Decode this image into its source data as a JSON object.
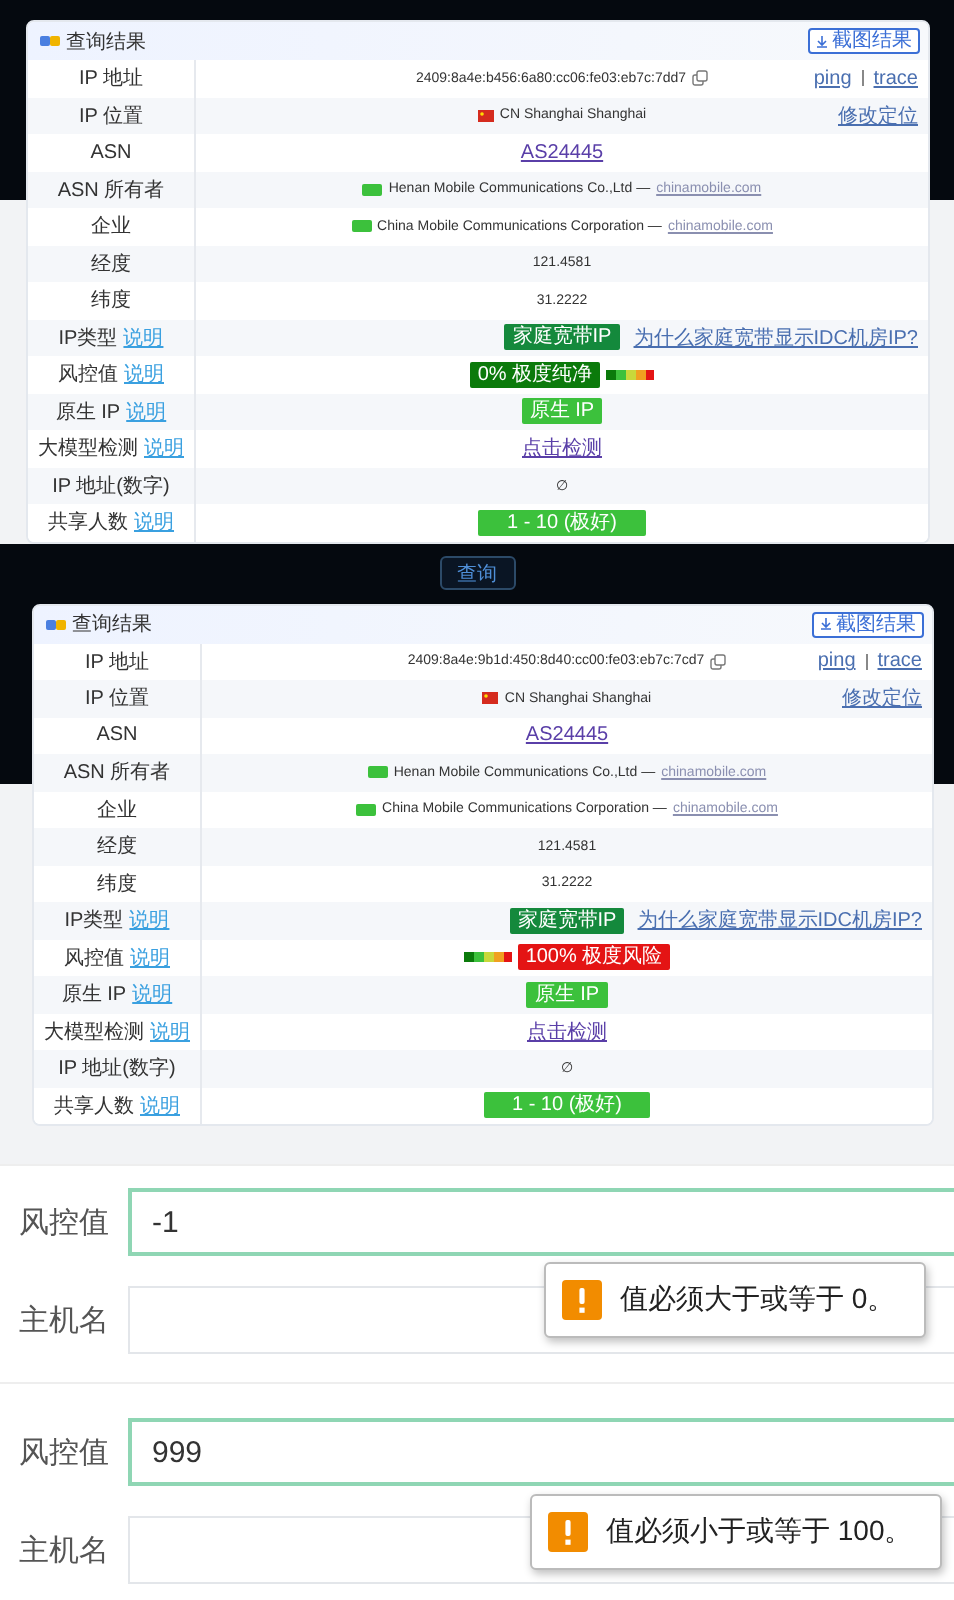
{
  "panels": [
    {
      "title": "查询结果",
      "action": "截图结果",
      "rows": [
        {
          "kind": "ip",
          "label": "IP 地址",
          "value": "2409:8a4e:b456:6a80:cc06:fe03:eb7c:7dd7",
          "links": [
            "ping",
            "trace"
          ]
        },
        {
          "kind": "location",
          "label": "IP 位置",
          "value": "CN Shanghai Shanghai",
          "links": [
            "修改定位"
          ]
        },
        {
          "kind": "link",
          "label": "ASN",
          "value": "AS24445"
        },
        {
          "kind": "org",
          "label": "ASN 所有者",
          "value": "Henan Mobile Communications Co.,Ltd —",
          "domain": "chinamobile.com"
        },
        {
          "kind": "org",
          "label": "企业",
          "value": "China Mobile Communications Corporation —",
          "domain": "chinamobile.com"
        },
        {
          "kind": "text",
          "label": "经度",
          "value": "121.4581"
        },
        {
          "kind": "text",
          "label": "纬度",
          "value": "31.2222"
        },
        {
          "kind": "badge",
          "label": "IP类型",
          "help": "说明",
          "value": "家庭宽带IP",
          "color": "#14893c",
          "links": [
            "为什么家庭宽带显示IDC机房IP?"
          ]
        },
        {
          "kind": "risk",
          "label": "风控值",
          "help": "说明",
          "value": "0%  极度纯净",
          "color": "#0b7a0b"
        },
        {
          "kind": "badge",
          "label": "原生 IP",
          "help": "说明",
          "value": "原生 IP",
          "color": "#3cc13c"
        },
        {
          "kind": "link",
          "label": "大模型检测",
          "help": "说明",
          "value": "点击检测"
        },
        {
          "kind": "text",
          "label": "IP 地址(数字)",
          "value": "∅"
        },
        {
          "kind": "wide-badge",
          "label": "共享人数",
          "help": "说明",
          "value": "1 - 10 (极好)",
          "color": "#3cc13c"
        }
      ],
      "search_button": "查询"
    },
    {
      "title": "查询结果",
      "action": "截图结果",
      "rows": [
        {
          "kind": "ip",
          "label": "IP 地址",
          "value": "2409:8a4e:9b1d:450:8d40:cc00:fe03:eb7c:7cd7",
          "links": [
            "ping",
            "trace"
          ]
        },
        {
          "kind": "location",
          "label": "IP 位置",
          "value": "CN Shanghai Shanghai",
          "links": [
            "修改定位"
          ]
        },
        {
          "kind": "link",
          "label": "ASN",
          "value": "AS24445"
        },
        {
          "kind": "org",
          "label": "ASN 所有者",
          "value": "Henan Mobile Communications Co.,Ltd —",
          "domain": "chinamobile.com"
        },
        {
          "kind": "org",
          "label": "企业",
          "value": "China Mobile Communications Corporation —",
          "domain": "chinamobile.com"
        },
        {
          "kind": "text",
          "label": "经度",
          "value": "121.4581"
        },
        {
          "kind": "text",
          "label": "纬度",
          "value": "31.2222"
        },
        {
          "kind": "badge",
          "label": "IP类型",
          "help": "说明",
          "value": "家庭宽带IP",
          "color": "#14893c",
          "links": [
            "为什么家庭宽带显示IDC机房IP?"
          ]
        },
        {
          "kind": "riskflipped",
          "label": "风控值",
          "help": "说明",
          "value": "100%  极度风险",
          "color": "#e41414"
        },
        {
          "kind": "badge",
          "label": "原生 IP",
          "help": "说明",
          "value": "原生 IP",
          "color": "#3cc13c"
        },
        {
          "kind": "link",
          "label": "大模型检测",
          "help": "说明",
          "value": "点击检测"
        },
        {
          "kind": "text",
          "label": "IP 地址(数字)",
          "value": "∅"
        },
        {
          "kind": "wide-badge",
          "label": "共享人数",
          "help": "说明",
          "value": "1 - 10 (极好)",
          "color": "#3cc13c"
        }
      ]
    }
  ],
  "forms": [
    {
      "fields": [
        {
          "label": "风控值",
          "value": "-1",
          "focused": true
        },
        {
          "label": "主机名",
          "focused": false
        }
      ],
      "tooltip": "值必须大于或等于 0。"
    },
    {
      "fields": [
        {
          "label": "风控值",
          "value": "999",
          "focused": true
        },
        {
          "label": "主机名",
          "focused": false
        }
      ],
      "tooltip": "值必须小于或等于 100。"
    }
  ]
}
